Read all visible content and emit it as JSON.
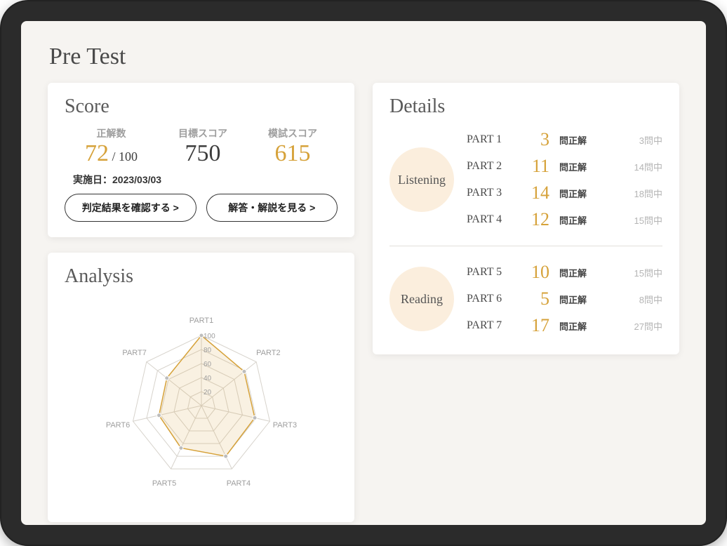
{
  "page_title": "Pre Test",
  "score": {
    "heading": "Score",
    "items": {
      "correct": {
        "label": "正解数",
        "value": "72",
        "denom": " / 100"
      },
      "target": {
        "label": "目標スコア",
        "value": "750"
      },
      "mock": {
        "label": "模試スコア",
        "value": "615"
      }
    },
    "date_label": "実施日：2023/03/03",
    "buttons": {
      "judge": "判定結果を確認する >",
      "answer": "解答・解説を見る >"
    }
  },
  "analysis": {
    "heading": "Analysis"
  },
  "details": {
    "heading": "Details",
    "correct_suffix": "問正解",
    "total_suffix": "問中",
    "sections": [
      {
        "name": "Listening",
        "parts": [
          {
            "label": "PART 1",
            "correct": 3,
            "total": 3
          },
          {
            "label": "PART 2",
            "correct": 11,
            "total": 14
          },
          {
            "label": "PART 3",
            "correct": 14,
            "total": 18
          },
          {
            "label": "PART 4",
            "correct": 12,
            "total": 15
          }
        ]
      },
      {
        "name": "Reading",
        "parts": [
          {
            "label": "PART 5",
            "correct": 10,
            "total": 15
          },
          {
            "label": "PART 6",
            "correct": 5,
            "total": 8
          },
          {
            "label": "PART 7",
            "correct": 17,
            "total": 27
          }
        ]
      }
    ]
  },
  "chart_data": {
    "type": "radar",
    "axes": [
      "PART1",
      "PART2",
      "PART3",
      "PART4",
      "PART5",
      "PART6",
      "PART7"
    ],
    "ticks": [
      20,
      40,
      60,
      80,
      100
    ],
    "max": 100,
    "values": [
      100,
      78,
      78,
      80,
      67,
      62,
      63
    ]
  }
}
